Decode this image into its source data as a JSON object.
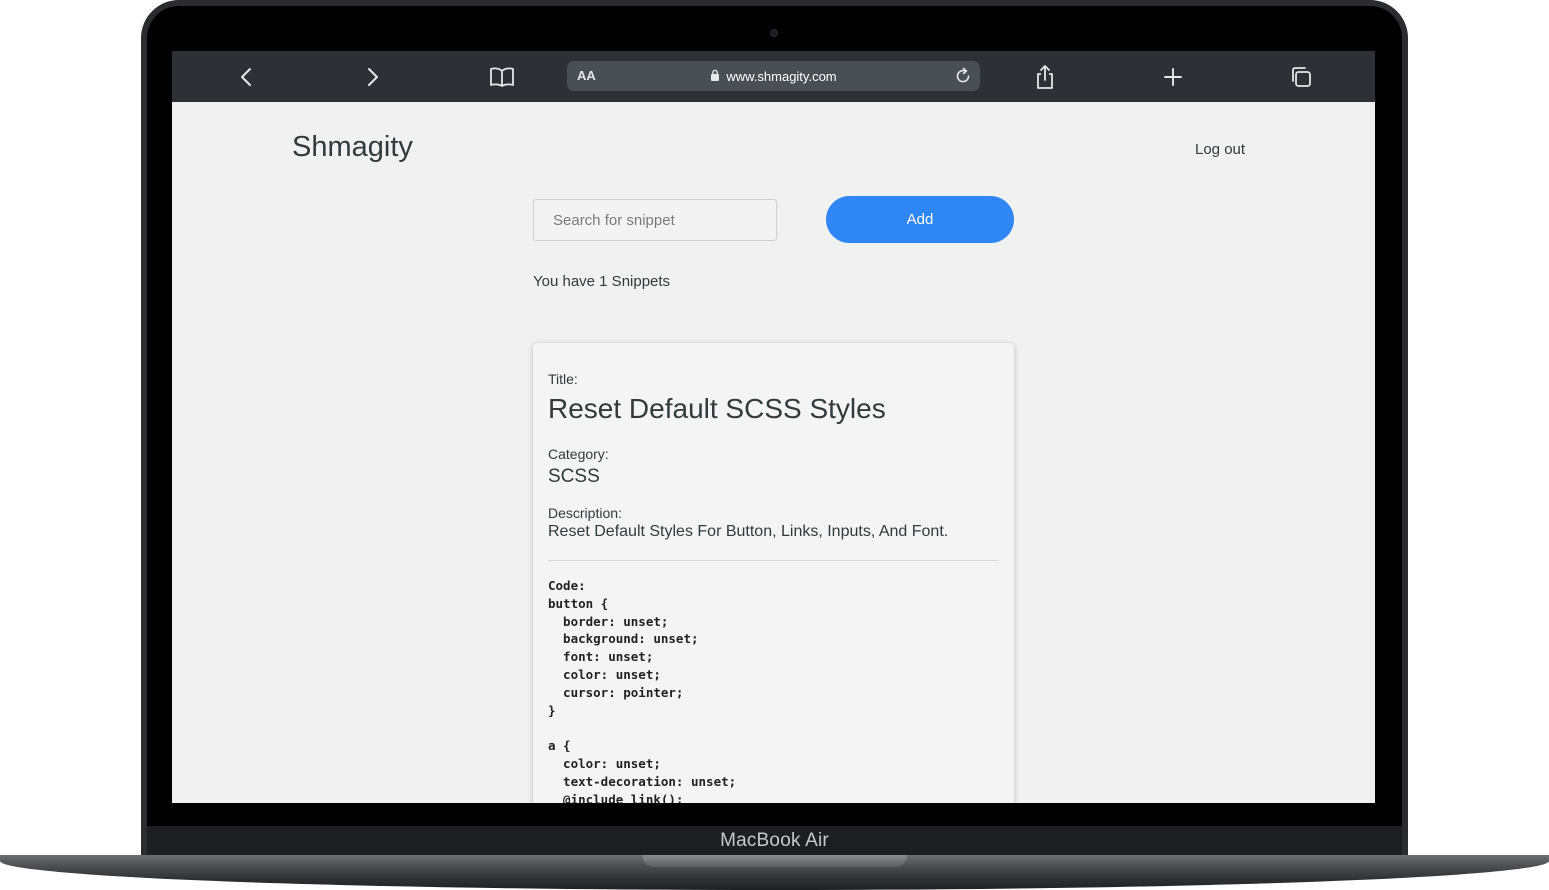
{
  "device": {
    "label": "MacBook Air"
  },
  "browser": {
    "text_size_label": "AA",
    "url": "www.shmagity.com",
    "icons": [
      "back-icon",
      "forward-icon",
      "bookmarks-icon",
      "lock-icon",
      "reload-icon",
      "share-icon",
      "new-tab-icon",
      "tabs-icon"
    ]
  },
  "header": {
    "brand": "Shmagity",
    "logout_label": "Log out"
  },
  "search": {
    "placeholder": "Search for snippet",
    "value": ""
  },
  "add_label": "Add",
  "snippet_count_text": "You have 1 Snippets",
  "colors": {
    "accent": "#2f86f5",
    "page_bg": "#f1f1f1",
    "toolbar_bg": "#2d3035"
  },
  "snippet": {
    "title_label": "Title:",
    "title": "Reset Default SCSS Styles",
    "category_label": "Category:",
    "category": "SCSS",
    "description_label": "Description:",
    "description": "Reset Default Styles For Button, Links, Inputs, And Font.",
    "code_label": "Code:",
    "code": "button {\n  border: unset;\n  background: unset;\n  font: unset;\n  color: unset;\n  cursor: pointer;\n}\n\na {\n  color: unset;\n  text-decoration: unset;\n  @include link();"
  }
}
